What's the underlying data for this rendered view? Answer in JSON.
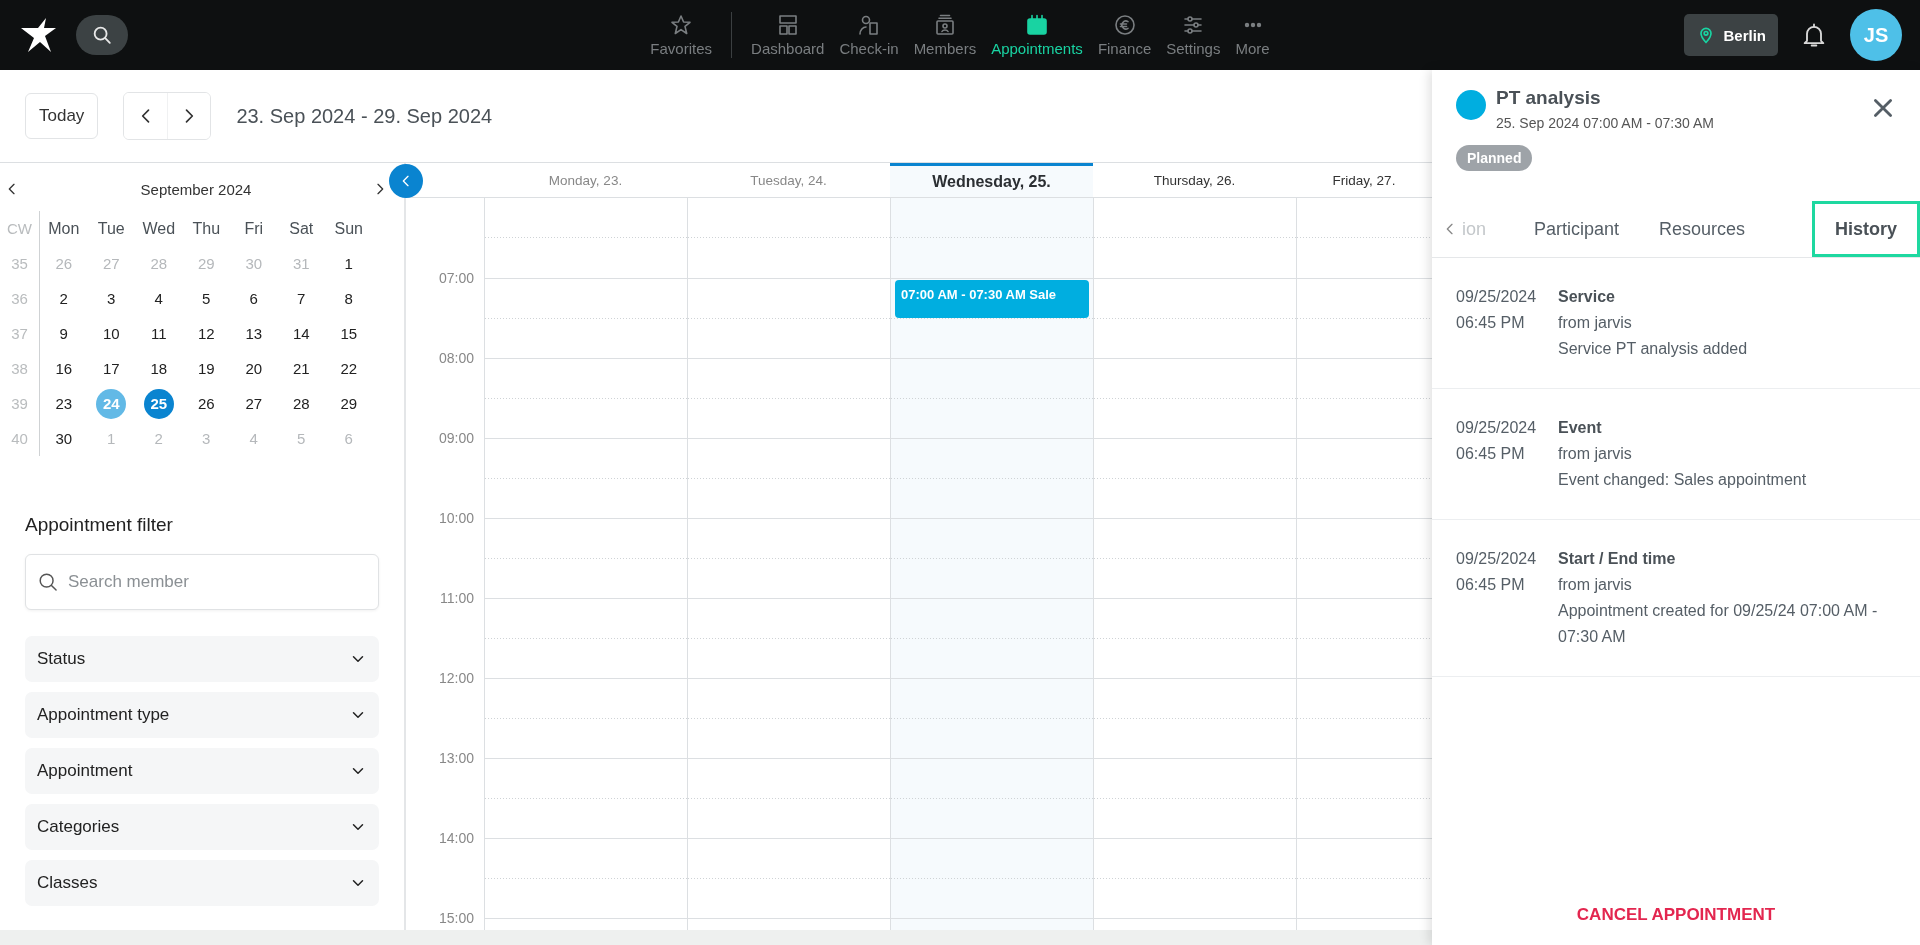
{
  "top_nav": {
    "favorites": {
      "label": "Favorites"
    },
    "items": [
      {
        "kind": "dashboard",
        "label": "Dashboard",
        "selected": false
      },
      {
        "kind": "checkin",
        "label": "Check-in",
        "selected": false
      },
      {
        "kind": "members",
        "label": "Members",
        "selected": false
      },
      {
        "kind": "appointments",
        "label": "Appointments",
        "selected": true
      },
      {
        "kind": "finance",
        "label": "Finance",
        "selected": false
      },
      {
        "kind": "settings",
        "label": "Settings",
        "selected": false
      },
      {
        "kind": "more",
        "label": "More",
        "selected": false
      }
    ],
    "location": "Berlin",
    "avatar": "JS"
  },
  "toolbar": {
    "today_button": "Today",
    "date_range": "23. Sep 2024 - 29. Sep 2024"
  },
  "mini_calendar": {
    "month": "September 2024",
    "cw_label": "CW",
    "weekdays": [
      "Mon",
      "Tue",
      "Wed",
      "Thu",
      "Fri",
      "Sat",
      "Sun"
    ],
    "weeks": [
      {
        "cw": "35",
        "days": [
          {
            "day": "26",
            "outside": true,
            "today": false,
            "selected": false
          },
          {
            "day": "27",
            "outside": true,
            "today": false,
            "selected": false
          },
          {
            "day": "28",
            "outside": true,
            "today": false,
            "selected": false
          },
          {
            "day": "29",
            "outside": true,
            "today": false,
            "selected": false
          },
          {
            "day": "30",
            "outside": true,
            "today": false,
            "selected": false
          },
          {
            "day": "31",
            "outside": true,
            "today": false,
            "selected": false
          },
          {
            "day": "1",
            "outside": false,
            "today": false,
            "selected": false
          }
        ]
      },
      {
        "cw": "36",
        "days": [
          {
            "day": "2",
            "outside": false,
            "today": false,
            "selected": false
          },
          {
            "day": "3",
            "outside": false,
            "today": false,
            "selected": false
          },
          {
            "day": "4",
            "outside": false,
            "today": false,
            "selected": false
          },
          {
            "day": "5",
            "outside": false,
            "today": false,
            "selected": false
          },
          {
            "day": "6",
            "outside": false,
            "today": false,
            "selected": false
          },
          {
            "day": "7",
            "outside": false,
            "today": false,
            "selected": false
          },
          {
            "day": "8",
            "outside": false,
            "today": false,
            "selected": false
          }
        ]
      },
      {
        "cw": "37",
        "days": [
          {
            "day": "9",
            "outside": false,
            "today": false,
            "selected": false
          },
          {
            "day": "10",
            "outside": false,
            "today": false,
            "selected": false
          },
          {
            "day": "11",
            "outside": false,
            "today": false,
            "selected": false
          },
          {
            "day": "12",
            "outside": false,
            "today": false,
            "selected": false
          },
          {
            "day": "13",
            "outside": false,
            "today": false,
            "selected": false
          },
          {
            "day": "14",
            "outside": false,
            "today": false,
            "selected": false
          },
          {
            "day": "15",
            "outside": false,
            "today": false,
            "selected": false
          }
        ]
      },
      {
        "cw": "38",
        "days": [
          {
            "day": "16",
            "outside": false,
            "today": false,
            "selected": false
          },
          {
            "day": "17",
            "outside": false,
            "today": false,
            "selected": false
          },
          {
            "day": "18",
            "outside": false,
            "today": false,
            "selected": false
          },
          {
            "day": "19",
            "outside": false,
            "today": false,
            "selected": false
          },
          {
            "day": "20",
            "outside": false,
            "today": false,
            "selected": false
          },
          {
            "day": "21",
            "outside": false,
            "today": false,
            "selected": false
          },
          {
            "day": "22",
            "outside": false,
            "today": false,
            "selected": false
          }
        ]
      },
      {
        "cw": "39",
        "days": [
          {
            "day": "23",
            "outside": false,
            "today": false,
            "selected": false
          },
          {
            "day": "24",
            "outside": false,
            "today": true,
            "selected": false
          },
          {
            "day": "25",
            "outside": false,
            "today": false,
            "selected": true
          },
          {
            "day": "26",
            "outside": false,
            "today": false,
            "selected": false
          },
          {
            "day": "27",
            "outside": false,
            "today": false,
            "selected": false
          },
          {
            "day": "28",
            "outside": false,
            "today": false,
            "selected": false
          },
          {
            "day": "29",
            "outside": false,
            "today": false,
            "selected": false
          }
        ]
      },
      {
        "cw": "40",
        "days": [
          {
            "day": "30",
            "outside": false,
            "today": false,
            "selected": false
          },
          {
            "day": "1",
            "outside": true,
            "today": false,
            "selected": false
          },
          {
            "day": "2",
            "outside": true,
            "today": false,
            "selected": false
          },
          {
            "day": "3",
            "outside": true,
            "today": false,
            "selected": false
          },
          {
            "day": "4",
            "outside": true,
            "today": false,
            "selected": false
          },
          {
            "day": "5",
            "outside": true,
            "today": false,
            "selected": false
          },
          {
            "day": "6",
            "outside": true,
            "today": false,
            "selected": false
          }
        ]
      }
    ]
  },
  "filter": {
    "title": "Appointment filter",
    "search": {
      "placeholder": "Search member"
    },
    "sections": [
      {
        "label": "Status",
        "expanded": false
      },
      {
        "label": "Appointment type",
        "expanded": false
      },
      {
        "label": "Appointment",
        "expanded": false
      },
      {
        "label": "Categories",
        "expanded": false
      },
      {
        "label": "Classes",
        "expanded": false
      }
    ]
  },
  "calendar": {
    "days": [
      {
        "label": "Monday, 23.",
        "past": true,
        "selected": false
      },
      {
        "label": "Tuesday, 24.",
        "past": true,
        "selected": false
      },
      {
        "label": "Wednesday, 25.",
        "past": false,
        "selected": true,
        "events": [
          {
            "text": "07:00 AM - 07:30 AM Sale"
          }
        ]
      },
      {
        "label": "Thursday, 26.",
        "past": false,
        "selected": false
      },
      {
        "label": "Friday, 27.",
        "past": false,
        "selected": false
      }
    ],
    "hours": [
      "07:00",
      "08:00",
      "09:00",
      "10:00",
      "11:00",
      "12:00",
      "13:00",
      "14:00",
      "15:00"
    ]
  },
  "panel": {
    "title": "PT analysis",
    "subtitle": "25. Sep 2024 07:00 AM - 07:30 AM",
    "status": "Planned",
    "tabs": [
      {
        "label": "ion",
        "selected": false
      },
      {
        "label": "Participant",
        "selected": false
      },
      {
        "label": "Resources",
        "selected": false
      },
      {
        "label": "History",
        "selected": true
      }
    ],
    "history": [
      {
        "date": "09/25/2024",
        "time": "06:45 PM",
        "title": "Service",
        "author": "from jarvis",
        "text": "Service PT analysis added"
      },
      {
        "date": "09/25/2024",
        "time": "06:45 PM",
        "title": "Event",
        "author": "from jarvis",
        "text": "Event changed: Sales appointment"
      },
      {
        "date": "09/25/2024",
        "time": "06:45 PM",
        "title": "Start / End time",
        "author": "from jarvis",
        "text": "Appointment created for 09/25/24 07:00 AM - 07:30 AM"
      }
    ],
    "cancel_button": "CANCEL APPOINTMENT"
  }
}
